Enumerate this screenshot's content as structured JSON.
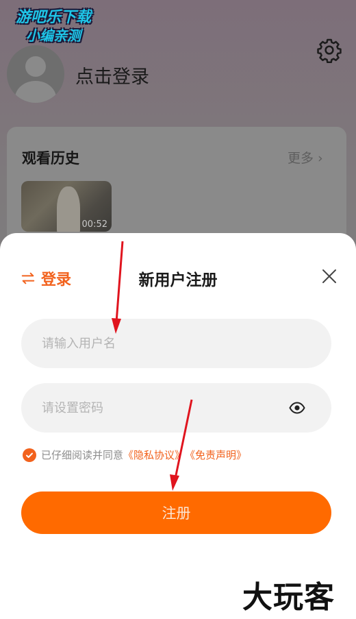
{
  "watermark_top": {
    "line1": "游吧乐下载",
    "line2": "小编亲测"
  },
  "profile": {
    "login_prompt": "点击登录"
  },
  "history": {
    "title": "观看历史",
    "more_label": "更多",
    "items": [
      {
        "duration": "00:52"
      }
    ]
  },
  "sheet": {
    "switch_label": "登录",
    "title": "新用户注册",
    "username_placeholder": "请输入用户名",
    "password_placeholder": "请设置密码",
    "agreement": {
      "prefix": "已仔细阅读并同意",
      "privacy_link": "《隐私协议》",
      "disclaimer_link": "《免责声明》",
      "checked": true
    },
    "register_label": "注册"
  },
  "watermark_bottom": "大玩客",
  "colors": {
    "accent": "#f2621d",
    "button": "#ff6a00",
    "annotation_arrow": "#e0141e"
  }
}
